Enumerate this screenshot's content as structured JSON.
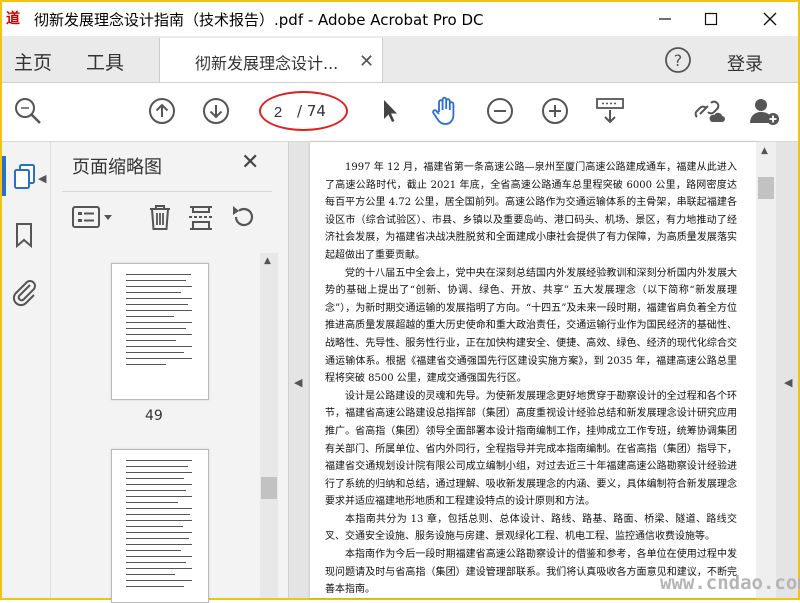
{
  "window": {
    "title": "彻新发展理念设计指南（技术报告）.pdf - Adobe Acrobat Pro DC",
    "logo_text": "道"
  },
  "menubar": {
    "home": "主页",
    "tools": "工具",
    "doc_tab": "彻新发展理念设计...",
    "login": "登录"
  },
  "toolbar": {
    "current_page": "2",
    "total_pages": "/ 74"
  },
  "thumbnails_panel": {
    "title": "页面缩略图",
    "visible_page_number": "49"
  },
  "document": {
    "paragraphs": [
      "1997 年 12 月，福建省第一条高速公路—泉州至厦门高速公路建成通车，福建从此进入了高速公路时代，截止 2021 年底，全省高速公路通车总里程突破 6000 公里，路网密度达每百平方公里 4.72 公里，居全国前列。高速公路作为交通运输体系的主骨架，串联起福建各设区市（综合试验区）、市县、乡镇以及重要岛屿、港口码头、机场、景区，有力地推动了经济社会发展，为福建省决战决胜脱贫和全面建成小康社会提供了有力保障，为高质量发展落实起超做出了重要贡献。",
      "党的十八届五中全会上，党中央在深刻总结国内外发展经验教训和深刻分析国内外发展大势的基础上提出了“创新、协调、绿色、开放、共享” 五大发展理念（以下简称“新发展理念”），为新时期交通运输的发展指明了方向。“十四五”及未来一段时期，福建省肩负着全方位推进高质量发展超越的重大历史使命和重大政治责任，交通运输行业作为国民经济的基础性、战略性、先导性、服务性行业，正在加快构建安全、便捷、高效、绿色、经济的现代化综合交通运输体系。根据《福建省交通强国先行区建设实施方案》，到 2035 年，福建高速公路总里程将突破 8500 公里，建成交通强国先行区。",
      "设计是公路建设的灵魂和先导。为使新发展理念更好地贯穿于勘察设计的全过程和各个环节，福建省高速公路建设总指挥部（集团）高度重视设计经验总结和新发展理念设计研究应用推广。省高指（集团）领导全面部署本设计指南编制工作，挂帅成立工作专班，统筹协调集团有关部门、所属单位、省内外同行，全程指导并完成本指南编制。在省高指（集团）指导下，福建省交通规划设计院有限公司成立编制小组，对过去近三十年福建高速公路勘察设计经验进行了系统的归纳和总结，通过理解、吸收新发展理念的内涵、要义，具体编制符合新发展理念要求并适应福建地形地质和工程建设特点的设计原则和方法。",
      "本指南共分为 13 章，包括总则、总体设计、路线、路基、路面、桥梁、隧道、路线交叉、交通安全设施、服务设施与房建、景观绿化工程、机电工程、监控通信收费设施等。",
      "本指南作为今后一段时期福建省高速公路勘察设计的借鉴和参考，各单位在使用过程中发现问题请及时与省高指（集团）建设管理部联系。我们将认真吸收各方面意见和建议，不断完善本指南。"
    ]
  },
  "watermark": "www.cndao.com",
  "colors": {
    "accent_blue": "#2a6fce",
    "annotation_red": "#e02020"
  }
}
